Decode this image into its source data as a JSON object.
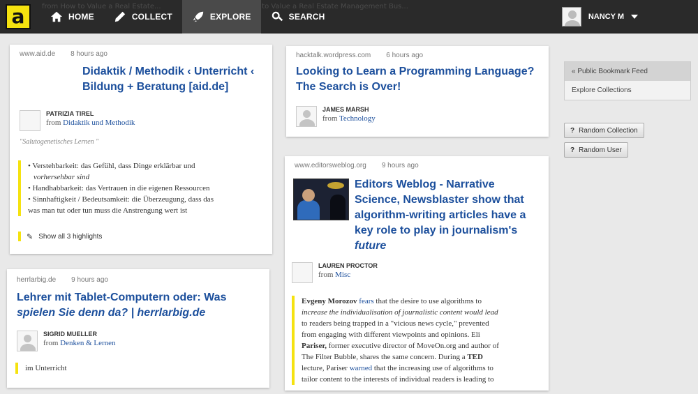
{
  "nav": {
    "logo": "a",
    "ghost_left": "from How to Value a Real Estate...",
    "ghost_right": "from How to Value a Real Estate Management Bus...",
    "items": [
      {
        "label": "Home",
        "icon": "home-icon"
      },
      {
        "label": "Collect",
        "icon": "pencil-icon"
      },
      {
        "label": "Explore",
        "icon": "rocket-icon"
      },
      {
        "label": "Search",
        "icon": "search-icon"
      }
    ],
    "user_name": "NANCY M"
  },
  "cards": {
    "aid": {
      "domain": "www.aid.de",
      "time": "8 hours ago",
      "title_line1": "Didaktik / Methodik ‹ Unterricht ‹",
      "title_line2": "Bildung + Beratung [aid.de]",
      "author": "PATRIZIA TIREL",
      "from_label": "from",
      "collection": "Didaktik und Methodik",
      "quote": "\"Salutogenetisches Lernen \"",
      "highlights": [
        "Verstehbarkeit: das Gefühl, dass Dinge erklärbar und",
        "vorhersehbar sind",
        "Handhabbarkeit: das Vertrauen in die eigenen Ressourcen",
        "Sinnhaftigkeit / Bedeutsamkeit: die Überzeugung, dass das",
        "was man tut oder tun muss die Anstrengung wert ist"
      ],
      "show_all": "Show all 3 highlights"
    },
    "herr": {
      "domain": "herrlarbig.de",
      "time": "9 hours ago",
      "title_line1": "Lehrer mit Tablet-Computern oder: Was",
      "title_line2": "spielen Sie denn da? | herrlarbig.de",
      "author": "SIGRID MUELLER",
      "from_label": "from",
      "collection": "Denken & Lernen",
      "highlight": "im Unterricht"
    },
    "hack": {
      "domain": "hacktalk.wordpress.com",
      "time": "6 hours ago",
      "title_line1": "Looking to Learn a Programming Language?",
      "title_line2": "The Search is Over!",
      "author": "JAMES MARSH",
      "from_label": "from",
      "collection": "Technology"
    },
    "editors": {
      "domain": "www.editorsweblog.org",
      "time": "9 hours ago",
      "title_line1": "Editors Weblog - Narrative",
      "title_line2": "Science, Newsblaster show that",
      "title_line3": "algorithm-writing articles have a",
      "title_line4": "key role to play in journalism's",
      "title_line5": "future",
      "author": "LAUREN PROCTOR",
      "from_label": "from",
      "collection": "Misc",
      "article": {
        "l1_a": "Evgeny Morozov",
        "l1_b": "fears",
        "l1_c": "that the desire to use algorithms to",
        "l2": "increase the individualisation of journalistic content would lead",
        "l3": "to readers being trapped in a \"vicious news cycle,\" prevented",
        "l4": "from engaging with different viewpoints and opinions. Eli",
        "l5_a": "Pariser,",
        "l5_b": "former executive director of MoveOn.org and author of",
        "l6_a": "The Filter Bubble, shares the same concern. During a",
        "l6_b": "TED",
        "l7_a": "lecture, Pariser",
        "l7_b": "warned",
        "l7_c": "that the increasing use of algorithms to",
        "l8": "tailor content to the interests of individual readers is leading to"
      }
    }
  },
  "sidebar": {
    "feed": "« Public Bookmark Feed",
    "explore": "Explore Collections",
    "random_collection": "Random Collection",
    "random_user": "Random User",
    "q": "?"
  }
}
